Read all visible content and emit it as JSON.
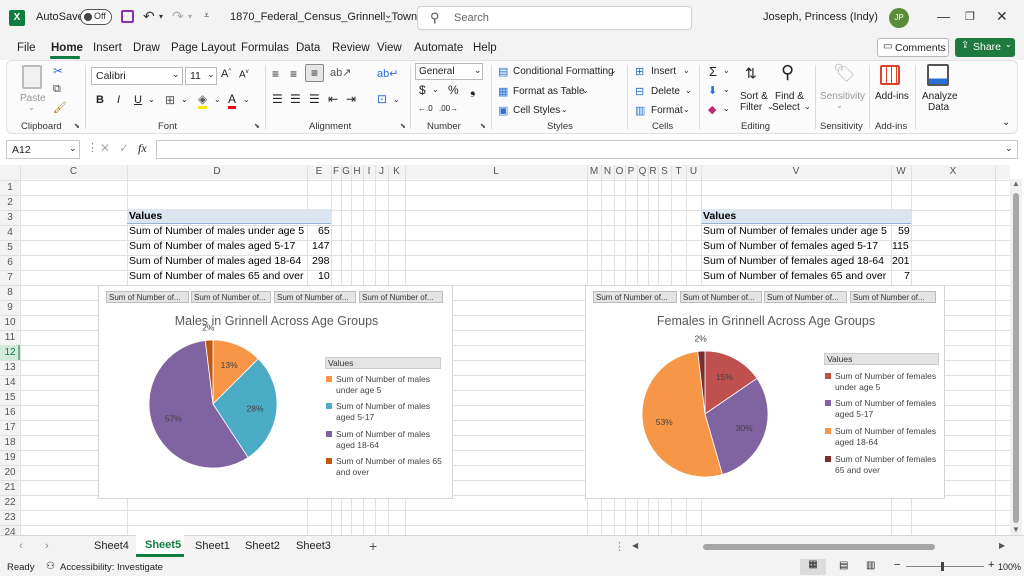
{
  "titlebar": {
    "autosave_label": "AutoSave",
    "autosave_state": "Off",
    "filename": "1870_Federal_Census_Grinnell_Town...",
    "search_placeholder": "Search",
    "user_name": "Joseph, Princess (Indy)",
    "user_initials": "JP"
  },
  "menu": {
    "items": [
      "File",
      "Home",
      "Insert",
      "Draw",
      "Page Layout",
      "Formulas",
      "Data",
      "Review",
      "View",
      "Automate",
      "Help"
    ],
    "active": "Home",
    "comments_label": "Comments",
    "share_label": "Share"
  },
  "ribbon": {
    "clipboard": {
      "paste": "Paste",
      "group": "Clipboard"
    },
    "font": {
      "name": "Calibri",
      "size": "11",
      "group": "Font"
    },
    "alignment": {
      "group": "Alignment"
    },
    "number": {
      "format": "General",
      "group": "Number"
    },
    "styles": {
      "conditional": "Conditional Formatting",
      "table": "Format as Table",
      "cell_styles": "Cell Styles",
      "group": "Styles"
    },
    "cells": {
      "insert": "Insert",
      "delete": "Delete",
      "format": "Format",
      "group": "Cells"
    },
    "editing": {
      "sort": "Sort &",
      "filter": "Filter",
      "find": "Find &",
      "select": "Select",
      "group": "Editing"
    },
    "sensitivity": {
      "label": "Sensitivity",
      "group": "Sensitivity"
    },
    "addins": {
      "label": "Add-ins",
      "group": "Add-ins"
    },
    "analyze": {
      "label1": "Analyze",
      "label2": "Data"
    }
  },
  "formula_bar": {
    "name_box": "A12",
    "fx": "fx",
    "content": ""
  },
  "columns": [
    "C",
    "D",
    "E",
    "F",
    "G",
    "H",
    "I",
    "J",
    "K",
    "L",
    "M",
    "N",
    "O",
    "P",
    "Q",
    "R",
    "S",
    "T",
    "U",
    "V",
    "W",
    "X"
  ],
  "rows": [
    "1",
    "2",
    "3",
    "4",
    "5",
    "6",
    "7",
    "8",
    "9",
    "10",
    "11",
    "12",
    "13",
    "14",
    "15",
    "16",
    "17",
    "18",
    "19",
    "20",
    "21",
    "22",
    "23",
    "24"
  ],
  "males_table": {
    "header": "Values",
    "rows": [
      {
        "label": "Sum of Number of males under age 5",
        "value": "65"
      },
      {
        "label": "Sum of Number of males aged 5-17",
        "value": "147"
      },
      {
        "label": "Sum of Number of males aged 18-64",
        "value": "298"
      },
      {
        "label": "Sum of Number of males 65 and over",
        "value": "10"
      }
    ]
  },
  "females_table": {
    "header": "Values",
    "rows": [
      {
        "label": "Sum of Number of females under age 5",
        "value": "59"
      },
      {
        "label": "Sum of Number of females aged 5-17",
        "value": "115"
      },
      {
        "label": "Sum of Number of females aged 18-64",
        "value": "201"
      },
      {
        "label": "Sum of Number of females 65 and over",
        "value": "7"
      }
    ]
  },
  "chart_data": [
    {
      "type": "pie",
      "title": "Males in Grinnell Across Age Groups",
      "field_buttons": [
        "Sum of Number of...",
        "Sum of Number of...",
        "Sum of Number of...",
        "Sum of Number of..."
      ],
      "legend_title": "Values",
      "legend_position": "right",
      "categories": [
        "Sum of Number of males under age 5",
        "Sum of Number of males aged 5-17",
        "Sum of Number of males aged 18-64",
        "Sum of Number of males 65 and over"
      ],
      "values": [
        65,
        147,
        298,
        10
      ],
      "data_labels": [
        "13%",
        "28%",
        "57%",
        "2%"
      ],
      "colors": [
        "#f79646",
        "#4bacc6",
        "#8064a2",
        "#c0590f"
      ]
    },
    {
      "type": "pie",
      "title": "Females in Grinnell Across Age Groups",
      "field_buttons": [
        "Sum of Number of...",
        "Sum of Number of...",
        "Sum of Number of...",
        "Sum of Number of..."
      ],
      "legend_title": "Values",
      "legend_position": "right",
      "categories": [
        "Sum of Number of females under age 5",
        "Sum of Number of females aged 5-17",
        "Sum of Number of females aged 18-64",
        "Sum of Number of females 65 and over"
      ],
      "values": [
        59,
        115,
        201,
        7
      ],
      "data_labels": [
        "15%",
        "30%",
        "53%",
        "2%"
      ],
      "colors": [
        "#c0504d",
        "#8064a2",
        "#f79646",
        "#7b2c2c"
      ]
    }
  ],
  "sheets": {
    "tabs": [
      "Sheet4",
      "Sheet5",
      "Sheet1",
      "Sheet2",
      "Sheet3"
    ],
    "active": "Sheet5",
    "add": "+"
  },
  "status": {
    "ready": "Ready",
    "accessibility": "Accessibility: Investigate",
    "zoom": "100%"
  },
  "colors": {
    "excel_green": "#107c41",
    "share_green": "#1f7a3f",
    "table_header": "#dce6f1",
    "selected_row": "#107c41"
  }
}
